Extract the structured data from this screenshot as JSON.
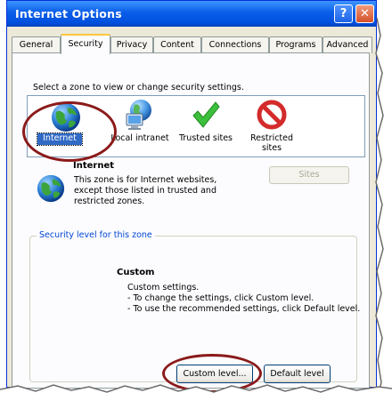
{
  "window": {
    "title": "Internet Options",
    "help_glyph": "?",
    "close_glyph": "✕"
  },
  "tabs": [
    {
      "label": "General"
    },
    {
      "label": "Security",
      "active": true
    },
    {
      "label": "Privacy"
    },
    {
      "label": "Content"
    },
    {
      "label": "Connections"
    },
    {
      "label": "Programs"
    },
    {
      "label": "Advanced"
    }
  ],
  "security": {
    "instruction": "Select a zone to view or change security settings.",
    "zones": [
      {
        "label": "Internet",
        "icon": "globe-icon",
        "selected": true
      },
      {
        "label": "Local intranet",
        "icon": "intranet-icon"
      },
      {
        "label": "Trusted sites",
        "icon": "checkmark-icon"
      },
      {
        "label": "Restricted sites",
        "icon": "prohibited-icon"
      }
    ],
    "zone_title": "Internet",
    "zone_description": "This zone is for Internet websites, except those listed in trusted and restricted zones.",
    "sites_button": "Sites",
    "level_group_title": "Security level for this zone",
    "level_name": "Custom",
    "level_lines": [
      "Custom settings.",
      "- To change the settings, click Custom level.",
      "- To use the recommended settings, click Default level."
    ],
    "custom_level_button": "Custom level...",
    "default_level_button": "Default level"
  },
  "colors": {
    "titlebar": "#0a5ee8",
    "annotation_ring": "#8b1a1a",
    "group_title": "#0046d5",
    "selection": "#316ac5"
  }
}
